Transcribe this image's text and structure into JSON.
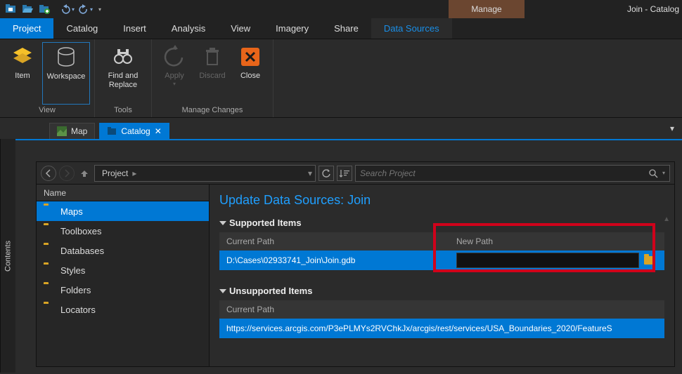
{
  "title_right": "Join - Catalog",
  "manage_tab": "Manage",
  "ribbon_tabs": [
    "Project",
    "Catalog",
    "Insert",
    "Analysis",
    "View",
    "Imagery",
    "Share",
    "Data Sources"
  ],
  "ribbon": {
    "view": {
      "item": "Item",
      "workspace": "Workspace",
      "label": "View"
    },
    "tools": {
      "find_replace": "Find and Replace",
      "label": "Tools"
    },
    "manage": {
      "apply": "Apply",
      "discard": "Discard",
      "close": "Close",
      "label": "Manage Changes"
    }
  },
  "contents_label": "Contents",
  "view_tabs": {
    "map": "Map",
    "catalog": "Catalog"
  },
  "breadcrumb": {
    "root": "Project",
    "search_placeholder": "Search Project"
  },
  "tree": {
    "header": "Name",
    "items": [
      "Maps",
      "Toolboxes",
      "Databases",
      "Styles",
      "Folders",
      "Locators"
    ]
  },
  "content": {
    "title": "Update Data Sources: Join",
    "supported": {
      "header": "Supported Items",
      "col_current": "Current Path",
      "col_new": "New Path",
      "row_path": "D:\\Cases\\02933741_Join\\Join.gdb"
    },
    "unsupported": {
      "header": "Unsupported Items",
      "col_current": "Current Path",
      "row_url": "https://services.arcgis.com/P3ePLMYs2RVChkJx/arcgis/rest/services/USA_Boundaries_2020/FeatureS"
    }
  }
}
